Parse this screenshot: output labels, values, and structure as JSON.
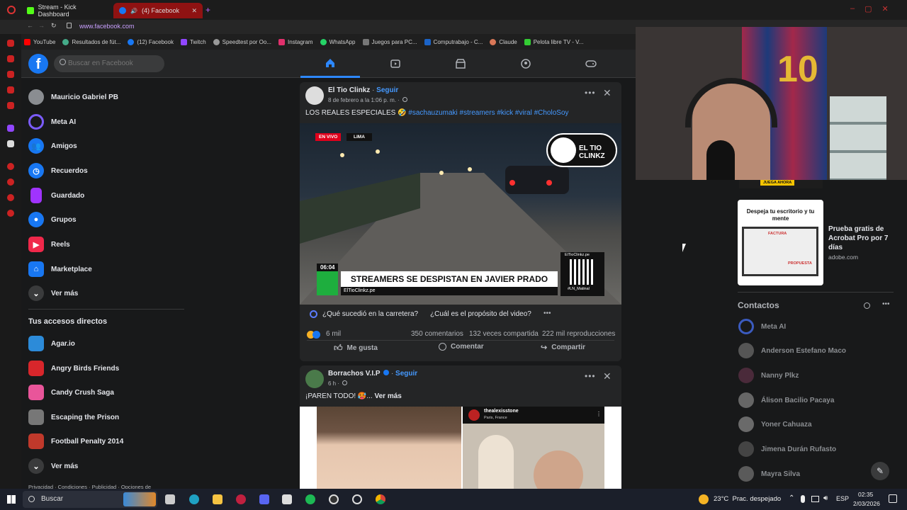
{
  "browser": {
    "tabs": [
      {
        "label": "Stream - Kick Dashboard",
        "active": false
      },
      {
        "label": "(4) Facebook",
        "active": true
      }
    ],
    "url": "www.facebook.com",
    "bookmarks": [
      "YouTube",
      "Resultados de fút...",
      "(12) Facebook",
      "Twitch",
      "Speedtest por Oo...",
      "Instagram",
      "WhatsApp",
      "Juegos para PC...",
      "Computrabajo - C...",
      "Claude",
      "Pelota libre TV - V..."
    ]
  },
  "fb": {
    "search_placeholder": "Buscar en Facebook",
    "left_menu": [
      {
        "label": "Mauricio Gabriel PB",
        "icon": "profile-avatar"
      },
      {
        "label": "Meta AI",
        "icon": "meta-ai-icon"
      },
      {
        "label": "Amigos",
        "icon": "friends-icon"
      },
      {
        "label": "Recuerdos",
        "icon": "clock-icon"
      },
      {
        "label": "Guardado",
        "icon": "bookmark-icon"
      },
      {
        "label": "Grupos",
        "icon": "groups-icon"
      },
      {
        "label": "Reels",
        "icon": "reels-icon"
      },
      {
        "label": "Marketplace",
        "icon": "marketplace-icon"
      },
      {
        "label": "Ver más",
        "icon": "chevron-down-icon"
      }
    ],
    "shortcuts_title": "Tus accesos directos",
    "shortcuts": [
      {
        "label": "Agar.io"
      },
      {
        "label": "Angry Birds Friends"
      },
      {
        "label": "Candy Crush Saga"
      },
      {
        "label": "Escaping the Prison"
      },
      {
        "label": "Football Penalty 2014"
      },
      {
        "label": "Ver más"
      }
    ],
    "footer": "Privacidad · Condiciones · Publicidad · Opciones de",
    "posts": [
      {
        "author": "El Tio Clinkz",
        "follow": "Seguir",
        "date": "8 de febrero a la 1:06 p. m. ·",
        "text": "LOS REALES ESPECIALES 🤣",
        "hashtags": "#sachauzumaki #streamers #kick #viral #CholoSoy",
        "video": {
          "live_badge": "EN VIVO",
          "location": "LIMA",
          "time": "06:04",
          "headline": "STREAMERS SE DESPISTAN EN JAVIER PRADO",
          "handle": "ElTioClinkz.pe",
          "brand": "EL TIO CLINKZ",
          "qr_caption": "#LN_Matinal",
          "qr_site": "ElTioClinkz.pe"
        },
        "ai_q1": "¿Qué sucedió en la carretera?",
        "ai_q2": "¿Cuál es el propósito del video?",
        "reactions": "6 mil",
        "comments": "350 comentarios",
        "shares": "132 veces compartida",
        "views": "222 mil reproducciones",
        "like": "Me gusta",
        "comment": "Comentar",
        "share": "Compartir"
      },
      {
        "author": "Borrachos V.I.P",
        "follow": "Seguir",
        "date": "6 h ·",
        "text": "¡PAREN TODO! 🥵...",
        "see_more": "Ver más",
        "embedded_user": "thealexisstone",
        "embedded_location": "Paris, France"
      }
    ],
    "ad": {
      "image_title": "Despeja tu escritorio y tu mente",
      "image_labels": [
        "FACTURA",
        "PROPUESTA"
      ],
      "title": "Prueba gratis de Acrobat Pro por 7 días",
      "domain": "adobe.com",
      "banner": "JUEGA AHORA"
    },
    "contacts_title": "Contactos",
    "contacts": [
      "Meta AI",
      "Anderson Estefano Maco",
      "Nanny Plkz",
      "Álison Bacilio Pacaya",
      "Yoner Cahuaza",
      "Jimena Durán Rufasto",
      "Mayra Silva"
    ]
  },
  "taskbar": {
    "search": "Buscar",
    "weather": "23°C  Prac. despejado",
    "lang": "ESP",
    "time": "02:35",
    "date": "2/03/2026"
  },
  "colors": {
    "fb_blue": "#1877f2",
    "link_blue": "#4599ff",
    "bg": "#18191a",
    "card": "#242526"
  }
}
